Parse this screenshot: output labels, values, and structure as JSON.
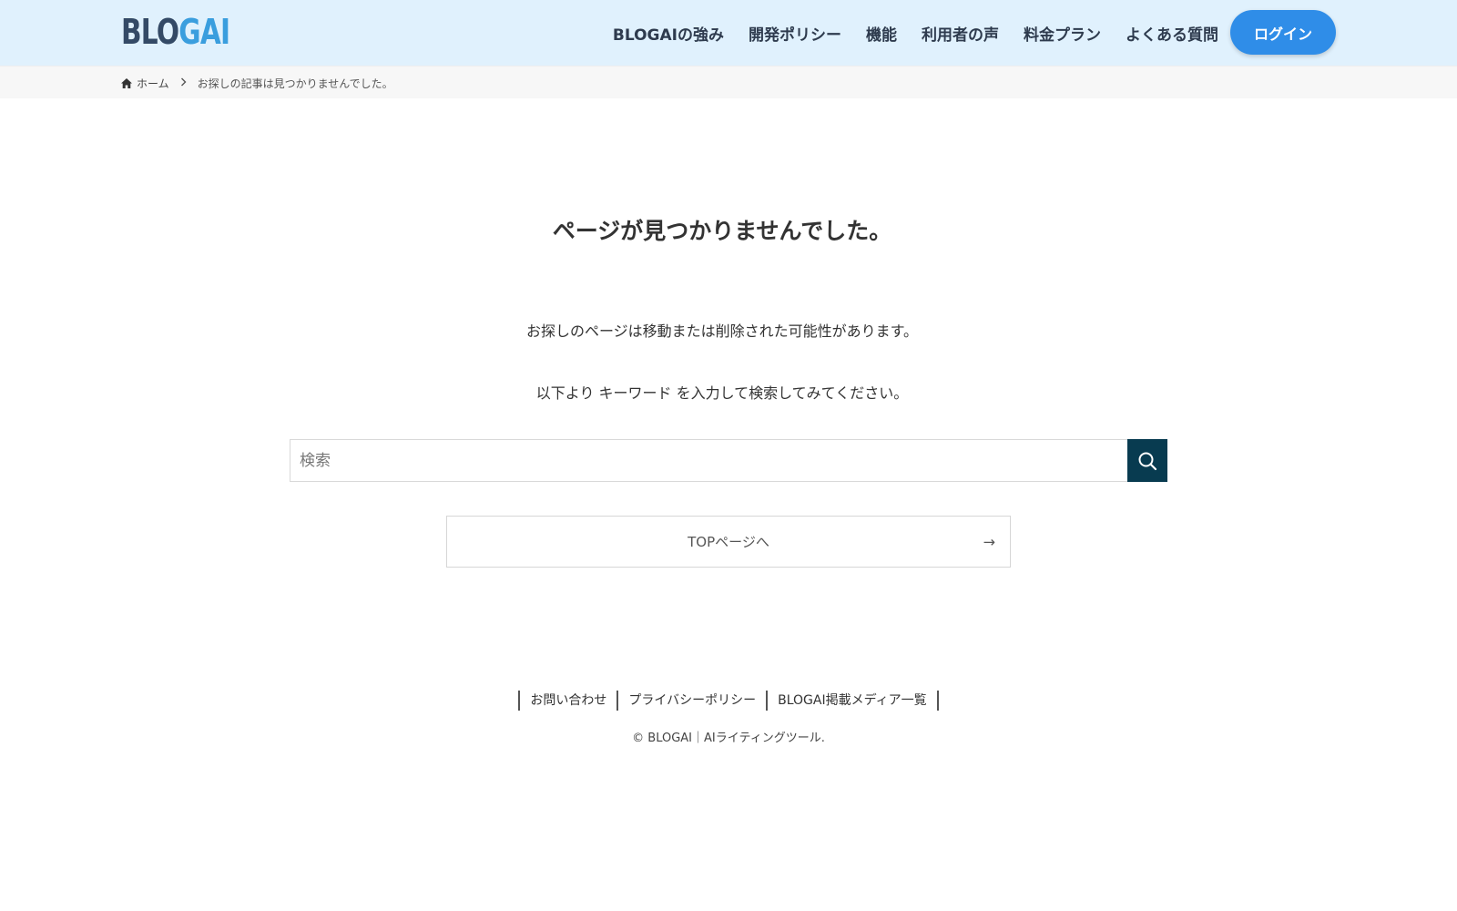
{
  "header": {
    "logo_part1": "BLO",
    "logo_part2": "GAI",
    "nav": [
      {
        "label": "BLOGAIの強み"
      },
      {
        "label": "開発ポリシー"
      },
      {
        "label": "機能"
      },
      {
        "label": "利用者の声"
      },
      {
        "label": "料金プラン"
      },
      {
        "label": "よくある質問"
      }
    ],
    "login_label": "ログイン"
  },
  "breadcrumb": {
    "home": "ホーム",
    "current": "お探しの記事は見つかりませんでした。"
  },
  "main": {
    "title": "ページが見つかりませんでした。",
    "message1": "お探しのページは移動または削除された可能性があります。",
    "message2": "以下より キーワード を入力して検索してみてください。",
    "search_placeholder": "検索",
    "search_value": "",
    "top_button_label": "TOPページへ",
    "top_button_arrow": "→"
  },
  "footer": {
    "links": [
      {
        "label": "お問い合わせ"
      },
      {
        "label": "プライバシーポリシー"
      },
      {
        "label": "BLOGAI掲載メディア一覧"
      }
    ],
    "copyright": "© BLOGAI｜AIライティングツール."
  },
  "icons": {
    "home": "home-icon",
    "chevron": "chevron-right-icon",
    "search": "search-icon",
    "arrow": "arrow-right-icon"
  },
  "colors": {
    "header_bg": "#e0f1fd",
    "logo_dark": "#344a66",
    "logo_light": "#3a9ede",
    "login_bg": "#2f8de8",
    "search_btn_bg": "#083b50"
  }
}
